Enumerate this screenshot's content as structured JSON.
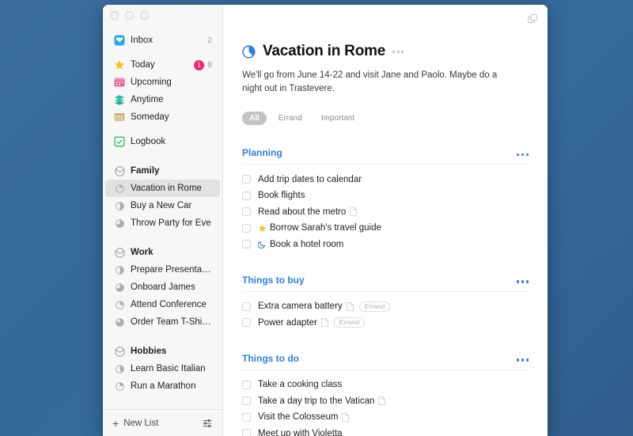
{
  "window": {
    "traffic_lights": [
      "close",
      "minimize",
      "zoom"
    ],
    "quick_entry_icon": "copy-overlap-icon"
  },
  "sidebar": {
    "nav": [
      {
        "icon": "inbox-tray-icon",
        "label": "Inbox",
        "count": "2",
        "badge": null,
        "selected": false
      },
      {
        "icon": "star-icon",
        "label": "Today",
        "count": "8",
        "badge": "1",
        "selected": false
      },
      {
        "icon": "calendar-icon",
        "label": "Upcoming",
        "count": null,
        "badge": null,
        "selected": false
      },
      {
        "icon": "layers-icon",
        "label": "Anytime",
        "count": null,
        "badge": null,
        "selected": false
      },
      {
        "icon": "box-icon",
        "label": "Someday",
        "count": null,
        "badge": null,
        "selected": false
      },
      {
        "icon": "logbook-icon",
        "label": "Logbook",
        "count": null,
        "badge": null,
        "selected": false
      }
    ],
    "groups": [
      {
        "name": "Family",
        "icon": "area-icon",
        "projects": [
          {
            "icon": "progress-pie-icon",
            "label": "Vacation in Rome",
            "progress": 15,
            "selected": true
          },
          {
            "icon": "progress-pie-icon",
            "label": "Buy a New Car",
            "progress": 50,
            "selected": false
          },
          {
            "icon": "progress-pie-icon",
            "label": "Throw Party for Eve",
            "progress": 70,
            "selected": false
          }
        ]
      },
      {
        "name": "Work",
        "icon": "area-icon",
        "projects": [
          {
            "icon": "progress-pie-icon",
            "label": "Prepare Presentation",
            "progress": 50,
            "selected": false
          },
          {
            "icon": "progress-pie-icon",
            "label": "Onboard James",
            "progress": 70,
            "selected": false
          },
          {
            "icon": "progress-pie-icon",
            "label": "Attend Conference",
            "progress": 25,
            "selected": false
          },
          {
            "icon": "progress-pie-icon",
            "label": "Order Team T-Shirts",
            "progress": 80,
            "selected": false
          }
        ]
      },
      {
        "name": "Hobbies",
        "icon": "area-icon",
        "projects": [
          {
            "icon": "progress-pie-icon",
            "label": "Learn Basic Italian",
            "progress": 45,
            "selected": false
          },
          {
            "icon": "progress-pie-icon",
            "label": "Run a Marathon",
            "progress": 20,
            "selected": false
          }
        ]
      }
    ],
    "footer": {
      "new_list_label": "New List",
      "new_list_icon": "plus-icon",
      "settings_icon": "sliders-icon"
    }
  },
  "project": {
    "title": "Vacation in Rome",
    "title_icon": "progress-pie-icon",
    "title_progress": 15,
    "more_icon": "more-dots-icon",
    "note": "We'll go from June 14-22 and visit Jane and Paolo. Maybe do a night out in Trastevere.",
    "filters": [
      {
        "label": "All",
        "active": true
      },
      {
        "label": "Errand",
        "active": false
      },
      {
        "label": "Important",
        "active": false
      }
    ]
  },
  "sections": [
    {
      "title": "Planning",
      "more_icon": "more-dots-icon",
      "todos": [
        {
          "text": "Add trip dates to calendar",
          "lead_icon": null,
          "note_icon": false,
          "tag": null
        },
        {
          "text": "Book flights",
          "lead_icon": null,
          "note_icon": false,
          "tag": null
        },
        {
          "text": "Read about the metro",
          "lead_icon": null,
          "note_icon": true,
          "tag": null
        },
        {
          "text": "Borrow Sarah's travel guide",
          "lead_icon": "star-icon",
          "note_icon": false,
          "tag": null
        },
        {
          "text": "Book a hotel room",
          "lead_icon": "moon-icon",
          "note_icon": false,
          "tag": null
        }
      ]
    },
    {
      "title": "Things to buy",
      "more_icon": "more-dots-icon",
      "todos": [
        {
          "text": "Extra camera battery",
          "lead_icon": null,
          "note_icon": true,
          "tag": "Errand"
        },
        {
          "text": "Power adapter",
          "lead_icon": null,
          "note_icon": true,
          "tag": "Errand"
        }
      ]
    },
    {
      "title": "Things to do",
      "more_icon": "more-dots-icon",
      "todos": [
        {
          "text": "Take a cooking class",
          "lead_icon": null,
          "note_icon": false,
          "tag": null
        },
        {
          "text": "Take a day trip to the Vatican",
          "lead_icon": null,
          "note_icon": true,
          "tag": null
        },
        {
          "text": "Visit the Colosseum",
          "lead_icon": null,
          "note_icon": true,
          "tag": null
        },
        {
          "text": "Meet up with Violetta",
          "lead_icon": null,
          "note_icon": false,
          "tag": null
        }
      ]
    }
  ],
  "colors": {
    "desktop_bg": "#35699b",
    "accent_blue": "#2f7fe0",
    "badge_pink": "#f3246e",
    "star_yellow": "#f5c21b",
    "sidebar_bg": "#f7f7f7"
  }
}
